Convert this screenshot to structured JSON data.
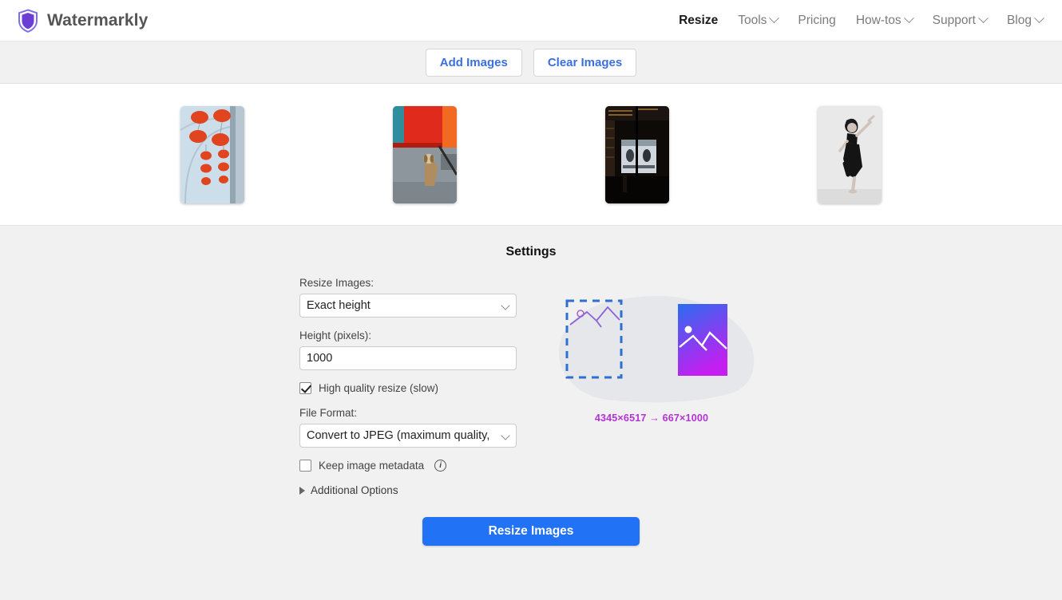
{
  "header": {
    "brand_name": "Watermarkly",
    "logo_icon": "shield-icon",
    "nav": [
      {
        "label": "Resize",
        "active": true,
        "has_caret": false
      },
      {
        "label": "Tools",
        "active": false,
        "has_caret": true
      },
      {
        "label": "Pricing",
        "active": false,
        "has_caret": false
      },
      {
        "label": "How-tos",
        "active": false,
        "has_caret": true
      },
      {
        "label": "Support",
        "active": false,
        "has_caret": true
      },
      {
        "label": "Blog",
        "active": false,
        "has_caret": true
      }
    ]
  },
  "toolbar": {
    "add_images_label": "Add Images",
    "clear_images_label": "Clear Images"
  },
  "thumbnails": [
    {
      "alt": "red lanterns against pale blue sky"
    },
    {
      "alt": "dog sitting on sidewalk by red building"
    },
    {
      "alt": "dark cafe interior at night"
    },
    {
      "alt": "black and white photo of dancing woman"
    }
  ],
  "settings": {
    "title": "Settings",
    "resize_label": "Resize Images:",
    "resize_value": "Exact height",
    "resize_options": [
      "Exact height"
    ],
    "height_label": "Height (pixels):",
    "height_value": "1000",
    "high_quality_label": "High quality resize (slow)",
    "high_quality_checked": true,
    "file_format_label": "File Format:",
    "file_format_value": "Convert to JPEG (maximum quality,",
    "file_format_options": [
      "Convert to JPEG (maximum quality,"
    ],
    "keep_metadata_label": "Keep image metadata",
    "keep_metadata_checked": false,
    "metadata_info_icon": "info-icon",
    "additional_options_label": "Additional Options",
    "additional_options_expanded": false
  },
  "preview": {
    "caption": "4345×6517 → 667×1000",
    "source_dimensions": "4345×6517",
    "result_dimensions": "667×1000"
  },
  "action": {
    "resize_button_label": "Resize Images"
  },
  "colors": {
    "primary_blue": "#2272f5",
    "link_blue": "#3b6fe0",
    "caption_purple": "#b431d6",
    "panel_gray": "#f1f1f1",
    "brand_purple": "#6b3fd4"
  }
}
